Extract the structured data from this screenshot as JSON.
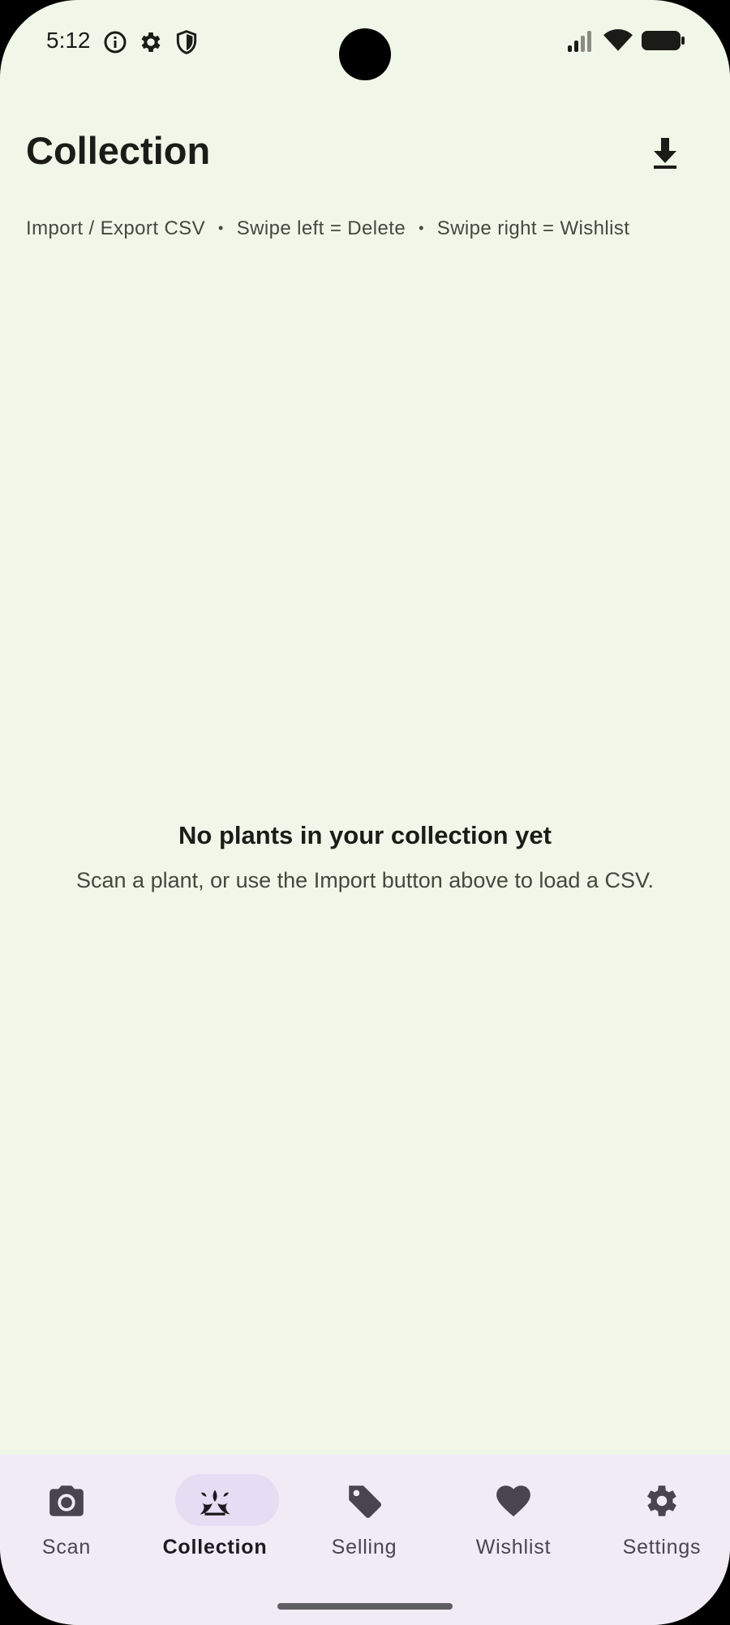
{
  "status_bar": {
    "time": "5:12",
    "icons_left": [
      "info-icon",
      "settings-gear-icon",
      "shield-icon"
    ],
    "icons_right": [
      "signal-icon",
      "wifi-icon",
      "battery-icon"
    ]
  },
  "header": {
    "title": "Collection",
    "action_icon": "download-icon",
    "hint_parts": [
      "Import / Export CSV",
      "Swipe left = Delete",
      "Swipe right = Wishlist"
    ],
    "separator": "•"
  },
  "empty_state": {
    "title": "No plants in your collection yet",
    "subtitle": "Scan a plant, or use the Import button above to load a CSV."
  },
  "nav": {
    "items": [
      {
        "label": "Scan",
        "icon": "camera-icon",
        "active": false
      },
      {
        "label": "Collection",
        "icon": "plant-icon",
        "active": true
      },
      {
        "label": "Selling",
        "icon": "tag-icon",
        "active": false
      },
      {
        "label": "Wishlist",
        "icon": "heart-icon",
        "active": false
      },
      {
        "label": "Settings",
        "icon": "gear-icon",
        "active": false
      }
    ]
  },
  "colors": {
    "background": "#f1f7e8",
    "nav_background": "#f0ebf5",
    "active_pill": "#e6dcf3",
    "text_primary": "#1b1c18",
    "text_secondary": "#44483e"
  }
}
